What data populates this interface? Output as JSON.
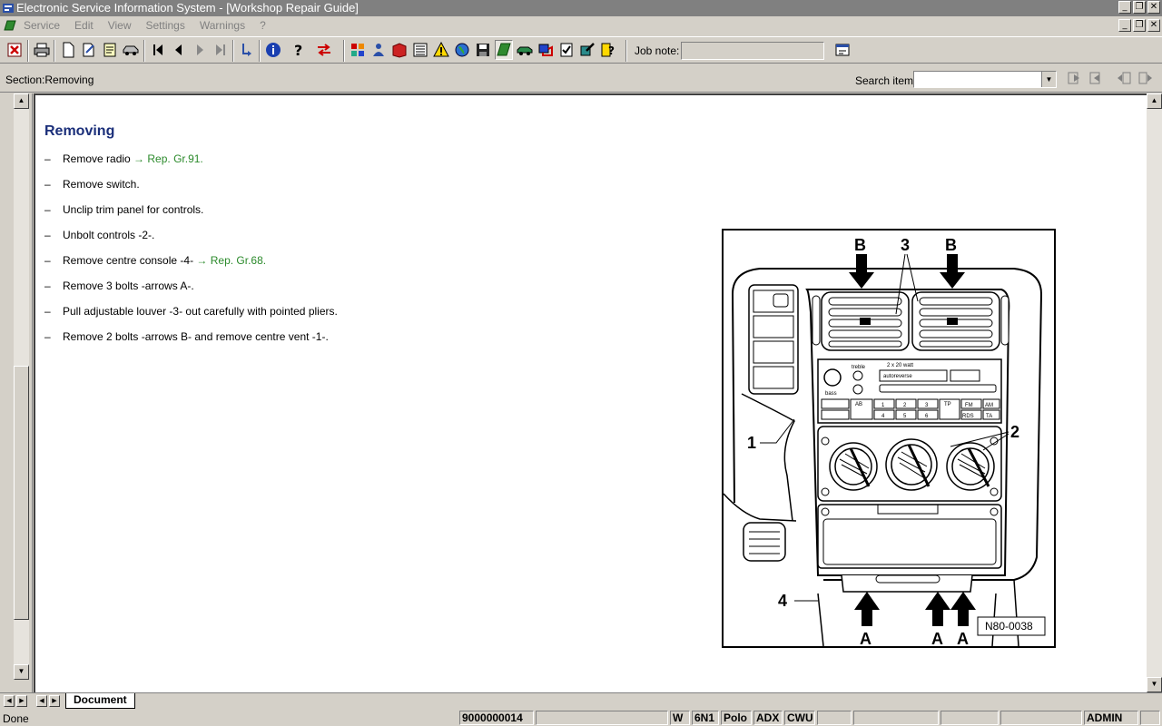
{
  "window": {
    "title": "Electronic Service Information System - [Workshop Repair Guide]",
    "minimize": "_",
    "restore": "❐",
    "close": "✕"
  },
  "menu": {
    "items": [
      "Service",
      "Edit",
      "View",
      "Settings",
      "Warnings",
      "?"
    ]
  },
  "toolbar": {
    "job_note_label": "Job note:",
    "job_note_value": "",
    "icons": [
      "exit-icon",
      "print-icon",
      "new-document-icon",
      "edit-document-icon",
      "notes-icon",
      "vehicle-icon",
      "first-page-icon",
      "previous-page-icon",
      "next-page-icon",
      "last-page-icon",
      "back-icon",
      "info-icon",
      "help-icon",
      "switch-icon",
      "components-icon",
      "users-icon",
      "manual-icon",
      "list-icon",
      "warning-icon",
      "globe-icon",
      "save-icon",
      "green-book-icon",
      "car-icon",
      "diagnosis-icon",
      "checklist-icon",
      "tools-icon",
      "user-help-icon"
    ]
  },
  "section": {
    "label": "Section:Removing",
    "search_label": "Search item:",
    "search_value": ""
  },
  "document": {
    "title": "Removing",
    "steps": [
      {
        "dash": "–",
        "text": "Remove radio ",
        "link": "→ Rep. Gr.91."
      },
      {
        "dash": "–",
        "text": "Remove switch.",
        "link": ""
      },
      {
        "dash": "–",
        "text": "Unclip trim panel for controls.",
        "link": ""
      },
      {
        "dash": "–",
        "text": "Unbolt controls -2-.",
        "link": ""
      },
      {
        "dash": "–",
        "text": "Remove centre console -4- ",
        "link": "→ Rep. Gr.68."
      },
      {
        "dash": "–",
        "text": "Remove 3 bolts -arrows A-.",
        "link": ""
      },
      {
        "dash": "–",
        "text": "Pull adjustable louver -3- out carefully with pointed pliers.",
        "link": ""
      },
      {
        "dash": "–",
        "text": "Remove 2 bolts -arrows B- and remove centre vent -1-.",
        "link": ""
      }
    ]
  },
  "figure": {
    "label_b": "B",
    "label_3": "3",
    "label_1": "1",
    "label_2": "2",
    "label_4": "4",
    "label_a": "A",
    "figure_id": "N80-0038",
    "radio_treble": "treble",
    "radio_bass": "bass",
    "radio_watt": "2 x 20 watt",
    "radio_autoreverse": "autoreverse",
    "radio_ab": "AB",
    "radio_tp": "TP",
    "radio_fm": "FM",
    "radio_am": "AM",
    "radio_rds": "RDS",
    "radio_ta": "TA",
    "radio_buttons": [
      "1",
      "2",
      "3",
      "4",
      "5",
      "6"
    ]
  },
  "tabs": {
    "document": "Document"
  },
  "status": {
    "state": "Done",
    "order_number": "9000000014",
    "cells": [
      "W",
      "6N1",
      "Polo",
      "ADX",
      "CWU"
    ],
    "user": "ADMIN"
  }
}
